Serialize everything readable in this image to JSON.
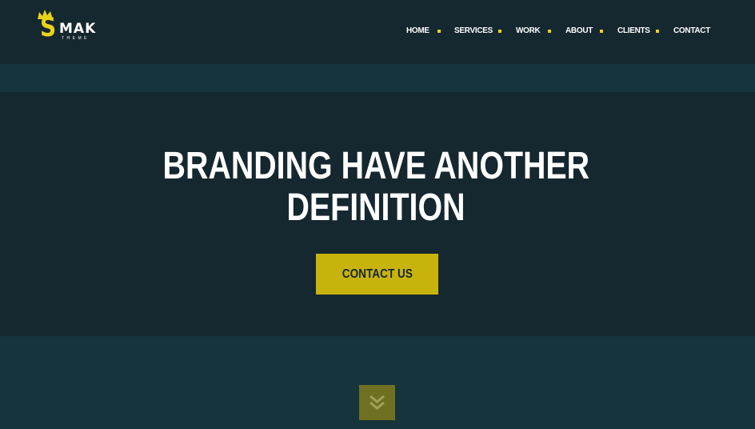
{
  "logo": {
    "letter": "S",
    "name": "MAK",
    "subtitle": "THEME"
  },
  "nav": {
    "items": [
      "HOME",
      "SERVICES",
      "WORK",
      "ABOUT",
      "CLIENTS",
      "CONTACT"
    ]
  },
  "hero": {
    "headline_line1": "BRANDING HAVE ANOTHER",
    "headline_line2": "DEFINITION",
    "cta_label": "CONTACT US"
  },
  "icons": {
    "logo_crown": "crown-icon",
    "scroll": "double-chevron-down-icon"
  },
  "colors": {
    "accent": "#e8d21a",
    "button": "#c8b30c",
    "header_bg": "#15272f",
    "section_bg": "#15343b",
    "text": "#ffffff"
  }
}
